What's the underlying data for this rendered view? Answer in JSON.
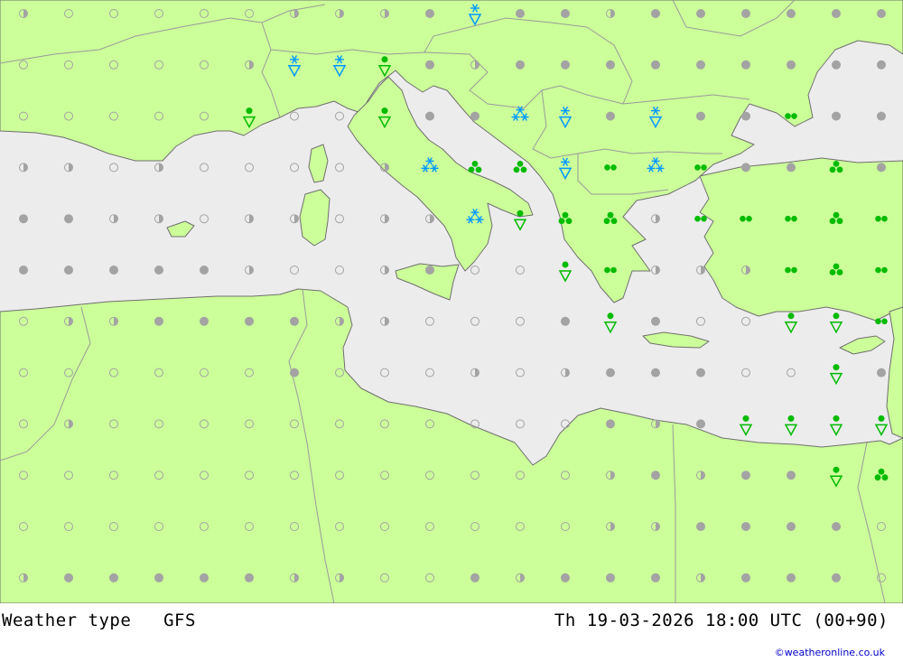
{
  "title": "Weather type   GFS",
  "datetime": "Th 19-03-2026 18:00 UTC (00+90)",
  "credit": "©weatheronline.co.uk",
  "colors": {
    "land": "#ccff99",
    "sea": "#ececec",
    "border": "#9a9a9a",
    "coast": "#6f6f6f",
    "dot": "#a3a3a3",
    "snow": "#0099ff",
    "rain": "#00bb00",
    "link": "#0000cc"
  },
  "grid": {
    "cols": 20,
    "rows": 12,
    "legend": "0 empty circle (clear), 1 half-filled circle (partly cloudy), 2 filled grey dot (cloudy), 3 snow shower, 4 snow, 5 rain shower, 6 light rain, 7 rain",
    "cells": [
      [
        1,
        0,
        0,
        0,
        0,
        0,
        1,
        1,
        1,
        2,
        3,
        2,
        2,
        1,
        2,
        2,
        2,
        2,
        2,
        2
      ],
      [
        0,
        0,
        0,
        0,
        0,
        1,
        3,
        3,
        5,
        2,
        1,
        2,
        2,
        2,
        2,
        2,
        2,
        2,
        2,
        2
      ],
      [
        0,
        0,
        0,
        0,
        0,
        5,
        0,
        0,
        5,
        2,
        2,
        4,
        3,
        2,
        3,
        2,
        2,
        6,
        2,
        2
      ],
      [
        1,
        1,
        0,
        1,
        0,
        0,
        0,
        0,
        1,
        4,
        7,
        7,
        3,
        6,
        4,
        6,
        2,
        2,
        7,
        2
      ],
      [
        2,
        2,
        1,
        1,
        0,
        1,
        1,
        0,
        1,
        1,
        4,
        5,
        7,
        7,
        1,
        6,
        6,
        6,
        7,
        6
      ],
      [
        2,
        2,
        2,
        2,
        2,
        1,
        0,
        0,
        1,
        2,
        0,
        0,
        5,
        6,
        1,
        1,
        1,
        6,
        7,
        6
      ],
      [
        0,
        1,
        1,
        2,
        2,
        2,
        2,
        1,
        1,
        0,
        0,
        0,
        2,
        5,
        2,
        0,
        0,
        5,
        5,
        6
      ],
      [
        0,
        0,
        0,
        0,
        0,
        0,
        2,
        0,
        0,
        0,
        1,
        0,
        1,
        2,
        2,
        2,
        0,
        0,
        5,
        2
      ],
      [
        0,
        1,
        0,
        0,
        0,
        0,
        0,
        0,
        0,
        0,
        0,
        0,
        0,
        2,
        1,
        2,
        5,
        5,
        5,
        5
      ],
      [
        0,
        0,
        0,
        0,
        0,
        0,
        0,
        0,
        0,
        0,
        0,
        0,
        0,
        1,
        2,
        1,
        2,
        2,
        5,
        7
      ],
      [
        0,
        0,
        0,
        0,
        0,
        0,
        0,
        0,
        0,
        0,
        0,
        0,
        0,
        1,
        1,
        2,
        2,
        2,
        2,
        0
      ],
      [
        1,
        2,
        2,
        2,
        2,
        2,
        1,
        1,
        0,
        0,
        2,
        1,
        2,
        2,
        2,
        1,
        2,
        2,
        2,
        0
      ]
    ]
  }
}
